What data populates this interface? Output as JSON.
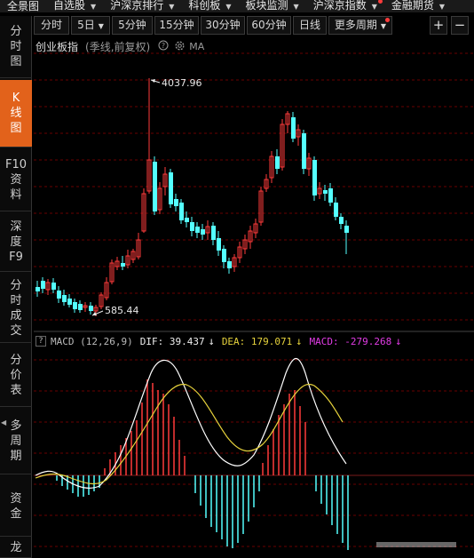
{
  "menubar": {
    "items": [
      {
        "label": "全景图",
        "caret": false
      },
      {
        "label": "自选股",
        "caret": true
      },
      {
        "label": "沪深京排行",
        "caret": true
      },
      {
        "label": "科创板",
        "caret": true
      },
      {
        "label": "板块监测",
        "caret": true
      },
      {
        "label": "沪深京指数",
        "caret": true
      },
      {
        "label": "金融期货",
        "caret": true
      }
    ]
  },
  "period_tabs": {
    "items": [
      "分时",
      "5日",
      "5分钟",
      "15分钟",
      "30分钟",
      "60分钟",
      "日线",
      "更多周期"
    ],
    "plus": "+",
    "minus": "−"
  },
  "sidenav": {
    "items": [
      {
        "chars": [
          "分",
          "时",
          "图"
        ],
        "active": false
      },
      {
        "chars": [
          "K",
          "线",
          "图"
        ],
        "active": true
      },
      {
        "chars": [
          "F10",
          "资",
          "料"
        ],
        "active": false
      },
      {
        "chars": [
          "深",
          "度",
          "F9"
        ],
        "active": false
      },
      {
        "chars": [
          "分",
          "时",
          "成",
          "交"
        ],
        "active": false
      },
      {
        "chars": [
          "分",
          "价",
          "表"
        ],
        "active": false
      },
      {
        "chars": [
          "多",
          "周",
          "期"
        ],
        "active": false
      },
      {
        "chars": [
          "资",
          "金"
        ],
        "active": false
      },
      {
        "chars": [
          "龙"
        ],
        "active": false
      }
    ]
  },
  "chart_header": {
    "name": "创业板指",
    "period_note": "(季线,前复权)",
    "ma_label": "MA"
  },
  "price_annotations": {
    "high": "4037.96",
    "low": "585.44"
  },
  "macd_header": {
    "help": "?",
    "name": "MACD (12,26,9)",
    "dif": "DIF: 39.437",
    "dea": "DEA: 179.071",
    "macd": "MACD: -279.268"
  },
  "colors": {
    "up": "#ff3b3b",
    "down": "#54ffff",
    "dif": "#ffffff",
    "dea": "#e6d23c",
    "macd": "#e23ce6",
    "active_tab": "#e2621b"
  },
  "chart_data": {
    "type": "candlestick",
    "series_name": "创业板指",
    "period": "季线",
    "annotations": {
      "high": 4037.96,
      "low": 585.44
    },
    "indicator": {
      "name": "MACD",
      "params": [
        12,
        26,
        9
      ],
      "dif": 39.437,
      "dea": 179.071,
      "macd": -279.268
    }
  }
}
